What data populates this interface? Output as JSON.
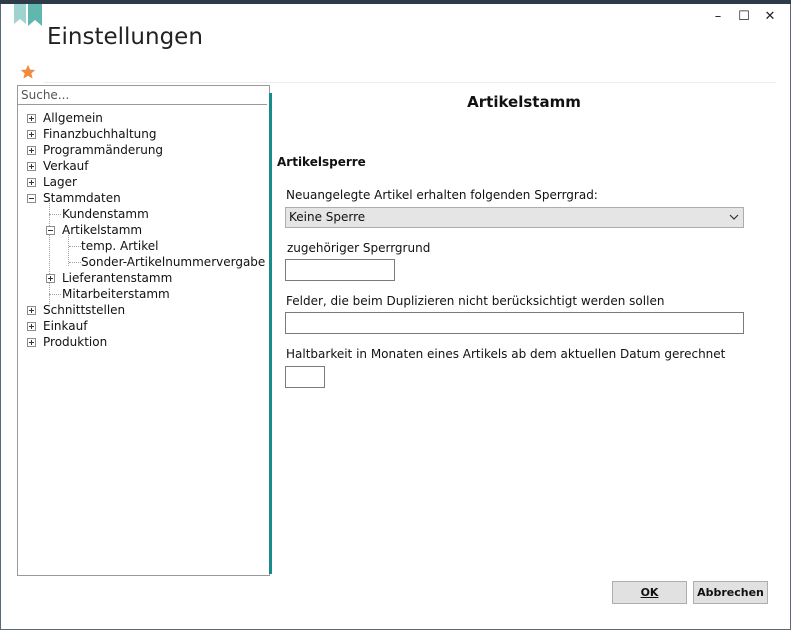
{
  "window": {
    "title": "Einstellungen",
    "controls": {
      "minimize": "–",
      "maximize": "☐",
      "close": "✕"
    }
  },
  "sidebar": {
    "search_placeholder": "Suche...",
    "tree": [
      {
        "label": "Allgemein",
        "level": 0,
        "expander": "plus"
      },
      {
        "label": "Finanzbuchhaltung",
        "level": 0,
        "expander": "plus"
      },
      {
        "label": "Programmänderung",
        "level": 0,
        "expander": "plus"
      },
      {
        "label": "Verkauf",
        "level": 0,
        "expander": "plus"
      },
      {
        "label": "Lager",
        "level": 0,
        "expander": "plus"
      },
      {
        "label": "Stammdaten",
        "level": 0,
        "expander": "minus"
      },
      {
        "label": "Kundenstamm",
        "level": 1,
        "expander": "none"
      },
      {
        "label": "Artikelstamm",
        "level": 1,
        "expander": "minus"
      },
      {
        "label": "temp. Artikel",
        "level": 2,
        "expander": "none"
      },
      {
        "label": "Sonder-Artikelnummervergabe",
        "level": 2,
        "expander": "none"
      },
      {
        "label": "Lieferantenstamm",
        "level": 1,
        "expander": "plus"
      },
      {
        "label": "Mitarbeiterstamm",
        "level": 1,
        "expander": "none"
      },
      {
        "label": "Schnittstellen",
        "level": 0,
        "expander": "plus"
      },
      {
        "label": "Einkauf",
        "level": 0,
        "expander": "plus"
      },
      {
        "label": "Produktion",
        "level": 0,
        "expander": "plus"
      }
    ]
  },
  "main": {
    "title": "Artikelstamm",
    "section": "Artikelsperre",
    "sperrgrad_label": "Neuangelegte Artikel erhalten folgenden Sperrgrad:",
    "sperrgrad_value": "Keine Sperre",
    "sperrgrund_label": "zugehöriger Sperrgrund",
    "sperrgrund_value": "",
    "duplizieren_label": "Felder, die beim Duplizieren nicht berücksichtigt werden sollen",
    "duplizieren_value": "",
    "haltbarkeit_label": "Haltbarkeit in Monaten eines Artikels ab dem aktuellen Datum gerechnet",
    "haltbarkeit_value": ""
  },
  "footer": {
    "ok_label": "OK",
    "cancel_label": "Abbrechen"
  },
  "colors": {
    "accent": "#1b8a8a",
    "ribbon": "#5fb7b0",
    "star": "#f28a3c"
  }
}
